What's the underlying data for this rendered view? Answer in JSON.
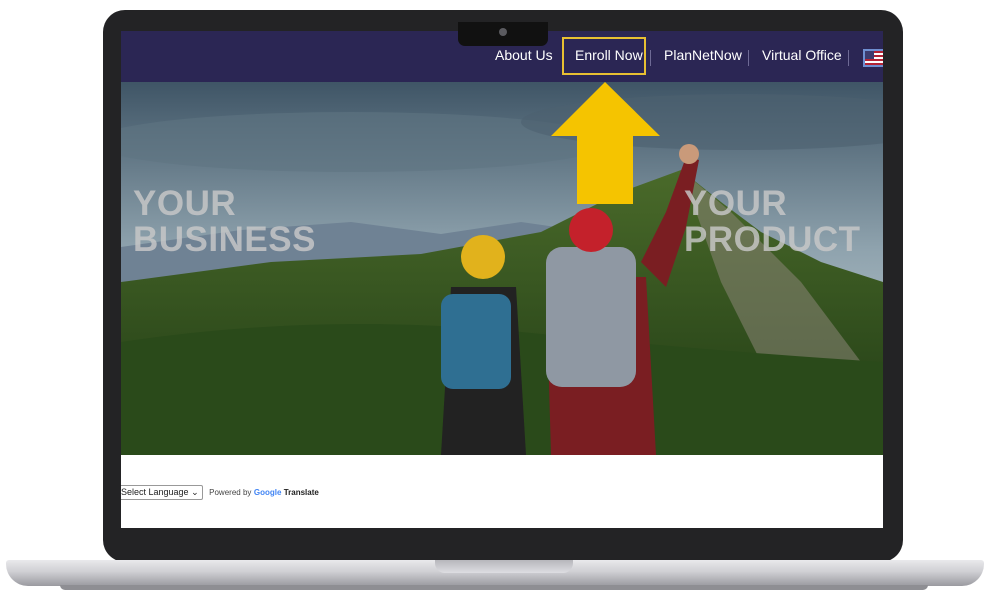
{
  "nav": {
    "items": [
      {
        "label": "About Us"
      },
      {
        "label": "Enroll Now"
      },
      {
        "label": "PlanNetNow"
      },
      {
        "label": "Virtual Office"
      }
    ]
  },
  "hero": {
    "left_text": [
      "YOUR",
      "BUSINESS"
    ],
    "right_text": [
      "YOUR",
      "PRODUCT"
    ]
  },
  "translate_widget": {
    "select_label": "Select Language",
    "powered_by": "Powered by",
    "google": "Google",
    "translate": "Translate"
  },
  "colors": {
    "navbar": "#2b2654",
    "highlight_box": "#e8c032",
    "arrow": "#f5c400"
  },
  "icons": {
    "flag": "us-flag-icon",
    "arrow": "up-arrow-icon"
  }
}
